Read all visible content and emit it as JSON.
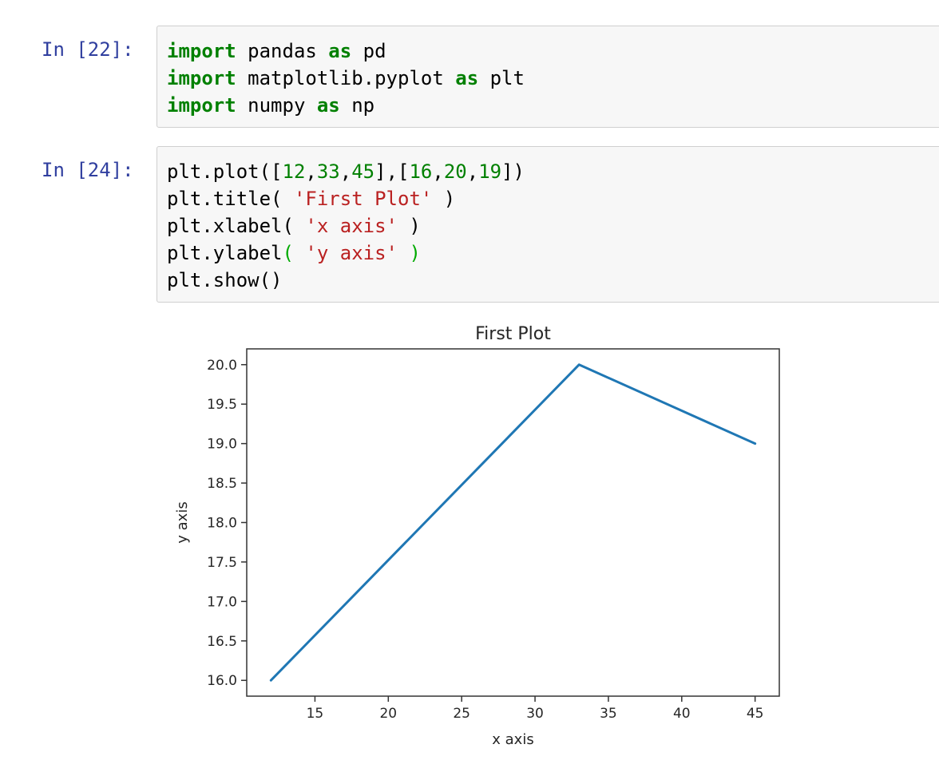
{
  "cells": [
    {
      "prompt": "In [22]:",
      "lines": [
        [
          {
            "t": "import",
            "c": "kw"
          },
          {
            "t": " pandas ",
            "c": ""
          },
          {
            "t": "as",
            "c": "kw"
          },
          {
            "t": " pd",
            "c": ""
          }
        ],
        [
          {
            "t": "import",
            "c": "kw"
          },
          {
            "t": " matplotlib.pyplot ",
            "c": ""
          },
          {
            "t": "as",
            "c": "kw"
          },
          {
            "t": " plt",
            "c": ""
          }
        ],
        [
          {
            "t": "import",
            "c": "kw"
          },
          {
            "t": " numpy ",
            "c": ""
          },
          {
            "t": "as",
            "c": "kw"
          },
          {
            "t": " np",
            "c": ""
          }
        ]
      ]
    },
    {
      "prompt": "In [24]:",
      "lines": [
        [
          {
            "t": "plt.plot([",
            "c": ""
          },
          {
            "t": "12",
            "c": "num"
          },
          {
            "t": ",",
            "c": ""
          },
          {
            "t": "33",
            "c": "num"
          },
          {
            "t": ",",
            "c": ""
          },
          {
            "t": "45",
            "c": "num"
          },
          {
            "t": "],[",
            "c": ""
          },
          {
            "t": "16",
            "c": "num"
          },
          {
            "t": ",",
            "c": ""
          },
          {
            "t": "20",
            "c": "num"
          },
          {
            "t": ",",
            "c": ""
          },
          {
            "t": "19",
            "c": "num"
          },
          {
            "t": "])",
            "c": ""
          }
        ],
        [
          {
            "t": "plt.title( ",
            "c": ""
          },
          {
            "t": "'First Plot'",
            "c": "str"
          },
          {
            "t": " )",
            "c": ""
          }
        ],
        [
          {
            "t": "plt.xlabel( ",
            "c": ""
          },
          {
            "t": "'x axis'",
            "c": "str"
          },
          {
            "t": " )",
            "c": ""
          }
        ],
        [
          {
            "t": "plt.ylabel",
            "c": ""
          },
          {
            "t": "( ",
            "c": "grn"
          },
          {
            "t": "'y axis'",
            "c": "str"
          },
          {
            "t": " )",
            "c": "grn"
          }
        ],
        [
          {
            "t": "plt.show()",
            "c": ""
          }
        ]
      ]
    }
  ],
  "chart_data": {
    "type": "line",
    "title": "First Plot",
    "xlabel": "x axis",
    "ylabel": "y axis",
    "x": [
      12,
      33,
      45
    ],
    "series": [
      {
        "values": [
          16,
          20,
          19
        ],
        "color": "#1f77b4"
      }
    ],
    "xlim": [
      10.35,
      46.65
    ],
    "ylim": [
      15.8,
      20.2
    ],
    "xticks": [
      15,
      20,
      25,
      30,
      35,
      40,
      45
    ],
    "xtick_labels": [
      "15",
      "20",
      "25",
      "30",
      "35",
      "40",
      "45"
    ],
    "yticks": [
      16.0,
      16.5,
      17.0,
      17.5,
      18.0,
      18.5,
      19.0,
      19.5,
      20.0
    ],
    "ytick_labels": [
      "16.0",
      "16.5",
      "17.0",
      "17.5",
      "18.0",
      "18.5",
      "19.0",
      "19.5",
      "20.0"
    ],
    "grid": false
  }
}
